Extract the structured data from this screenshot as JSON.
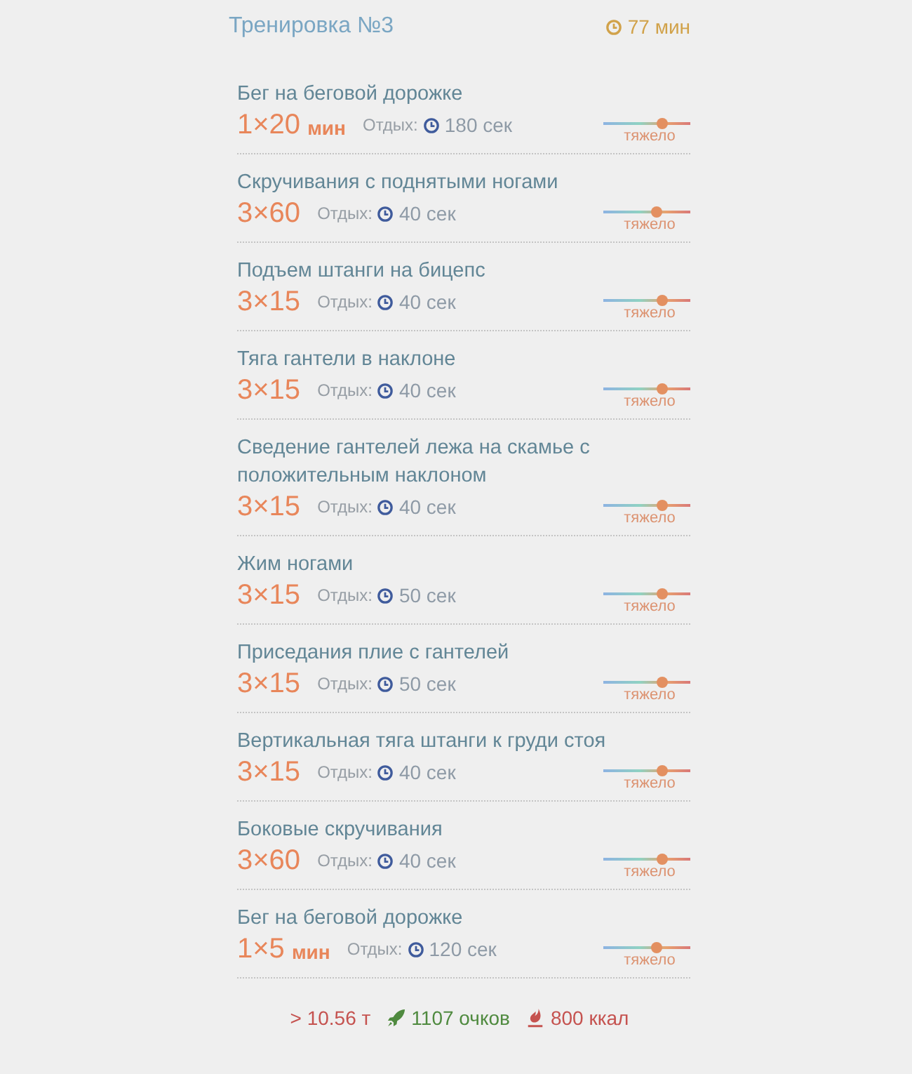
{
  "header": {
    "title": "Тренировка №3",
    "duration": "77 мин"
  },
  "exercises": [
    {
      "title": "Бег на беговой дорожке",
      "sets": "1×20",
      "unit": "мин",
      "rest_label": "Отдых:",
      "rest": "180 сек",
      "difficulty": {
        "level": 0.68,
        "label": "тяжело"
      }
    },
    {
      "title": "Скручивания с поднятыми ногами",
      "sets": "3×60",
      "rest_label": "Отдых:",
      "rest": "40 сек",
      "difficulty": {
        "level": 0.61,
        "label": "тяжело"
      }
    },
    {
      "title": "Подъем штанги на бицепс",
      "sets": "3×15",
      "rest_label": "Отдых:",
      "rest": "40 сек",
      "difficulty": {
        "level": 0.68,
        "label": "тяжело"
      }
    },
    {
      "title": "Тяга гантели в наклоне",
      "sets": "3×15",
      "rest_label": "Отдых:",
      "rest": "40 сек",
      "difficulty": {
        "level": 0.68,
        "label": "тяжело"
      }
    },
    {
      "title": "Сведение гантелей лежа на скамье с положительным наклоном",
      "sets": "3×15",
      "rest_label": "Отдых:",
      "rest": "40 сек",
      "difficulty": {
        "level": 0.68,
        "label": "тяжело"
      }
    },
    {
      "title": "Жим ногами",
      "sets": "3×15",
      "rest_label": "Отдых:",
      "rest": "50 сек",
      "difficulty": {
        "level": 0.68,
        "label": "тяжело"
      }
    },
    {
      "title": "Приседания плие с гантелей",
      "sets": "3×15",
      "rest_label": "Отдых:",
      "rest": "50 сек",
      "difficulty": {
        "level": 0.68,
        "label": "тяжело"
      }
    },
    {
      "title": "Вертикальная тяга штанги к груди стоя",
      "sets": "3×15",
      "rest_label": "Отдых:",
      "rest": "40 сек",
      "difficulty": {
        "level": 0.68,
        "label": "тяжело"
      }
    },
    {
      "title": "Боковые скручивания",
      "sets": "3×60",
      "rest_label": "Отдых:",
      "rest": "40 сек",
      "difficulty": {
        "level": 0.68,
        "label": "тяжело"
      }
    },
    {
      "title": "Бег на беговой дорожке",
      "sets": "1×5",
      "unit": "мин",
      "rest_label": "Отдых:",
      "rest": "120 сек",
      "difficulty": {
        "level": 0.61,
        "label": "тяжело"
      }
    }
  ],
  "summary": [
    {
      "kind": "weight",
      "text": "> 10.56 т"
    },
    {
      "kind": "points",
      "text": "1107 очков"
    },
    {
      "kind": "calories",
      "text": "800 ккал"
    }
  ]
}
